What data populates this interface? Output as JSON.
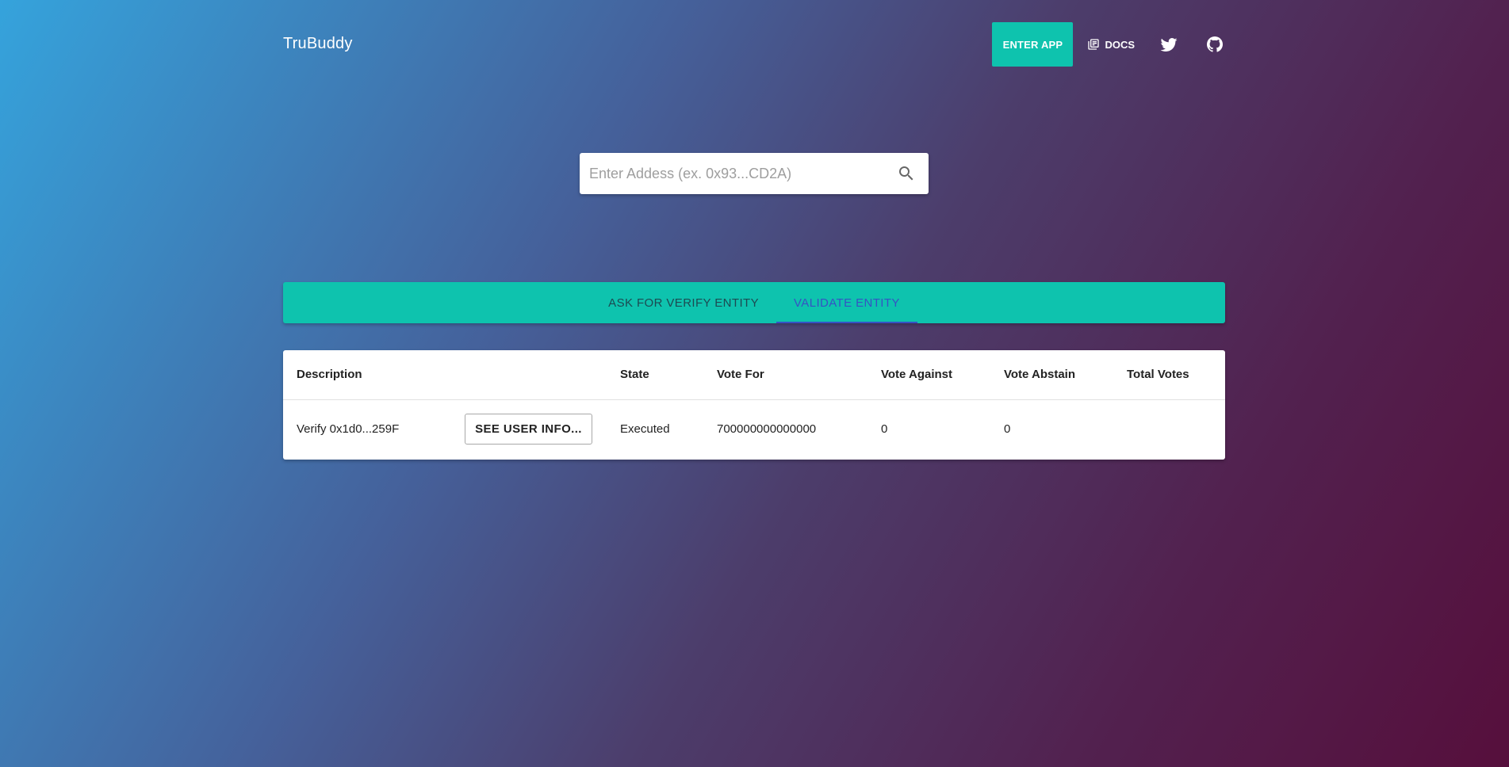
{
  "header": {
    "brand": "TruBuddy",
    "enter_app_label": "ENTER APP",
    "docs_label": "DOCS",
    "docs_icon": "docs-icon",
    "twitter_icon": "twitter-icon",
    "github_icon": "github-icon"
  },
  "search": {
    "placeholder": "Enter Addess (ex. 0x93...CD2A)",
    "value": "",
    "icon": "search-icon"
  },
  "tabs": [
    {
      "label": "ASK FOR VERIFY ENTITY",
      "active": false
    },
    {
      "label": "VALIDATE ENTITY",
      "active": true
    }
  ],
  "table": {
    "columns": [
      "Description",
      "State",
      "Vote For",
      "Vote Against",
      "Vote Abstain",
      "Total Votes"
    ],
    "rows": [
      {
        "description": "Verify 0x1d0...259F",
        "action_label": "SEE USER INFO...",
        "state": "Executed",
        "vote_for": "700000000000000",
        "vote_against": "0",
        "vote_abstain": "0",
        "total_votes": ""
      }
    ]
  },
  "colors": {
    "accent": "#0ec3ae",
    "active_tab": "#3553c4"
  }
}
